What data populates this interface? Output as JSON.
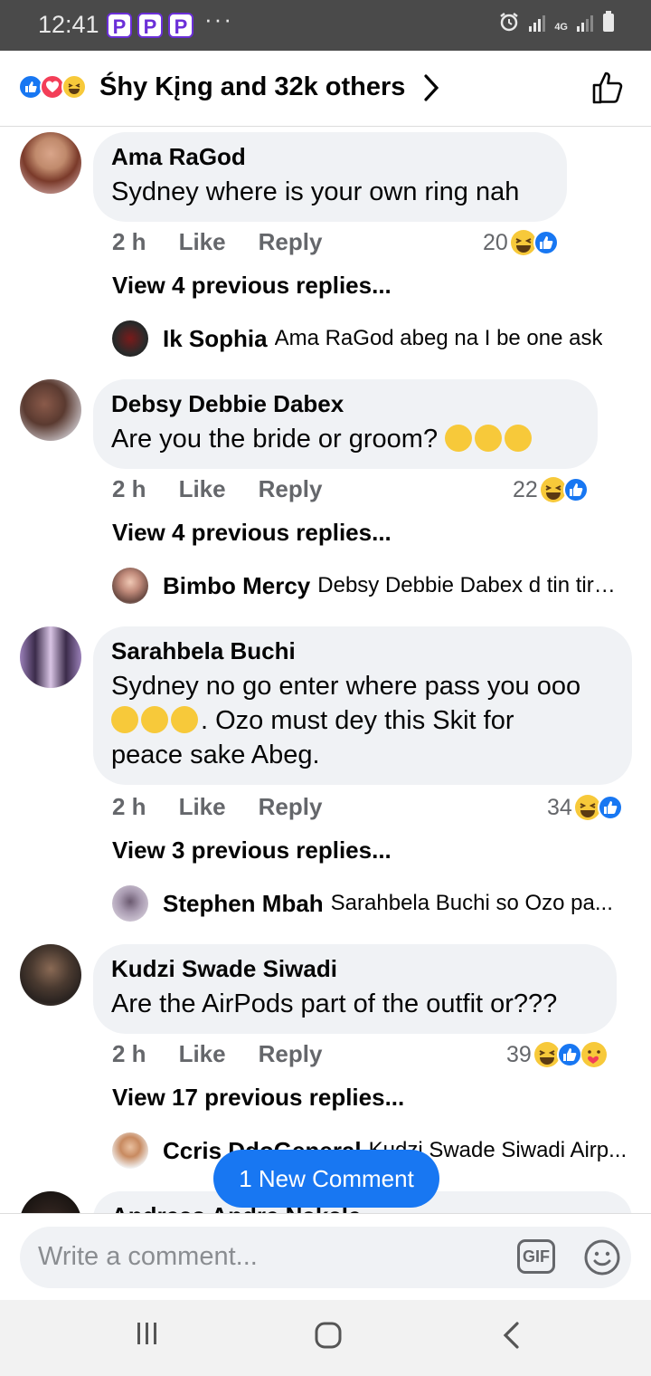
{
  "status": {
    "time": "12:41",
    "badges": [
      "P",
      "P",
      "P"
    ],
    "more": "···",
    "network": "4G"
  },
  "header": {
    "reactors": "Śhy Kįng and 32k others"
  },
  "comments": [
    {
      "author": "Ama RaGod",
      "text": "Sydney where is your own ring nah",
      "time": "2 h",
      "like": "Like",
      "reply": "Reply",
      "count": "20",
      "view_prev": "View 4 previous replies...",
      "last_reply": {
        "name": "Ik Sophia",
        "text": "Ama RaGod abeg na I be one ask"
      }
    },
    {
      "author": "Debsy Debbie Dabex",
      "text": "Are you the bride or groom?",
      "time": "2 h",
      "like": "Like",
      "reply": "Reply",
      "count": "22",
      "view_prev": "View 4 previous replies...",
      "last_reply": {
        "name": "Bimbo Mercy",
        "text": "Debsy Debbie Dabex d tin tire ..."
      }
    },
    {
      "author": "Sarahbela Buchi",
      "text1": "Sydney no go enter where pass you ooo",
      "text2": ". Ozo must dey this Skit for",
      "text3": "peace sake Abeg.",
      "time": "2 h",
      "like": "Like",
      "reply": "Reply",
      "count": "34",
      "view_prev": "View 3 previous replies...",
      "last_reply": {
        "name": "Stephen Mbah",
        "text": "Sarahbela Buchi  so Ozo pa..."
      }
    },
    {
      "author": "Kudzi Swade Siwadi",
      "text": "Are the AirPods part of the outfit or???",
      "time": "2 h",
      "like": "Like",
      "reply": "Reply",
      "count": "39",
      "view_prev": "View 17 previous replies...",
      "last_reply": {
        "name": "Ccris DdoGeneral",
        "text": "Kudzi Swade Siwadi Airp..."
      }
    },
    {
      "author": "Andreas Andre Nakale"
    }
  ],
  "new_comment_pill": "1 New Comment",
  "composer": {
    "placeholder": "Write a comment...",
    "gif": "GIF"
  },
  "colors": {
    "accent": "#1877f2",
    "bubble": "#f0f2f5",
    "meta": "#65676b",
    "statusbar": "#4a4a4a"
  }
}
